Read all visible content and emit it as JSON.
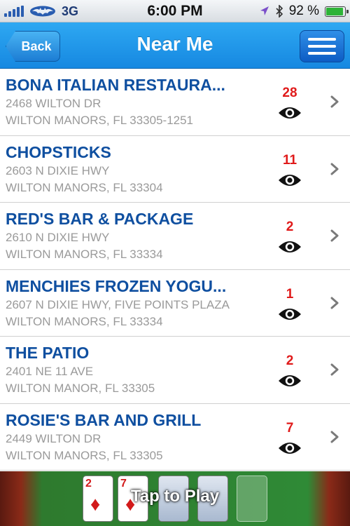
{
  "status_bar": {
    "network": "3G",
    "time": "6:00 PM",
    "battery": "92 %",
    "battery_level": 0.92
  },
  "nav": {
    "back_label": "Back",
    "title": "Near Me"
  },
  "locations": [
    {
      "name": "BONA ITALIAN RESTAURA...",
      "address1": "2468 WILTON DR",
      "address2": "WILTON MANORS, FL 33305-1251",
      "count": "28"
    },
    {
      "name": "CHOPSTICKS",
      "address1": "2603 N DIXIE HWY",
      "address2": "WILTON MANORS, FL 33304",
      "count": "11"
    },
    {
      "name": "RED'S BAR & PACKAGE",
      "address1": "2610 N DIXIE HWY",
      "address2": "WILTON MANORS, FL 33334",
      "count": "2"
    },
    {
      "name": "MENCHIES FROZEN YOGU...",
      "address1": "2607 N DIXIE HWY, FIVE POINTS PLAZA",
      "address2": "WILTON MANORS, FL 33334",
      "count": "1"
    },
    {
      "name": "THE PATIO",
      "address1": "2401 NE 11 AVE",
      "address2": "WILTON MANOR, FL 33305",
      "count": "2"
    },
    {
      "name": "ROSIE'S BAR AND GRILL",
      "address1": "2449 WILTON DR",
      "address2": "WILTON MANORS, FL 33305",
      "count": "7"
    }
  ],
  "ad": {
    "label": "Tap to Play",
    "cards": [
      {
        "rank": "2",
        "suit": "♦"
      },
      {
        "rank": "7",
        "suit": "♦"
      }
    ]
  },
  "colors": {
    "nav_bar": "#1a8ee6",
    "title_text": "#0f4fa0",
    "count_text": "#e01a1a",
    "address_text": "#9a9a9a"
  },
  "icons": {
    "eye": "eye-icon",
    "chevron": "chevron-right-icon",
    "menu": "hamburger-icon"
  }
}
